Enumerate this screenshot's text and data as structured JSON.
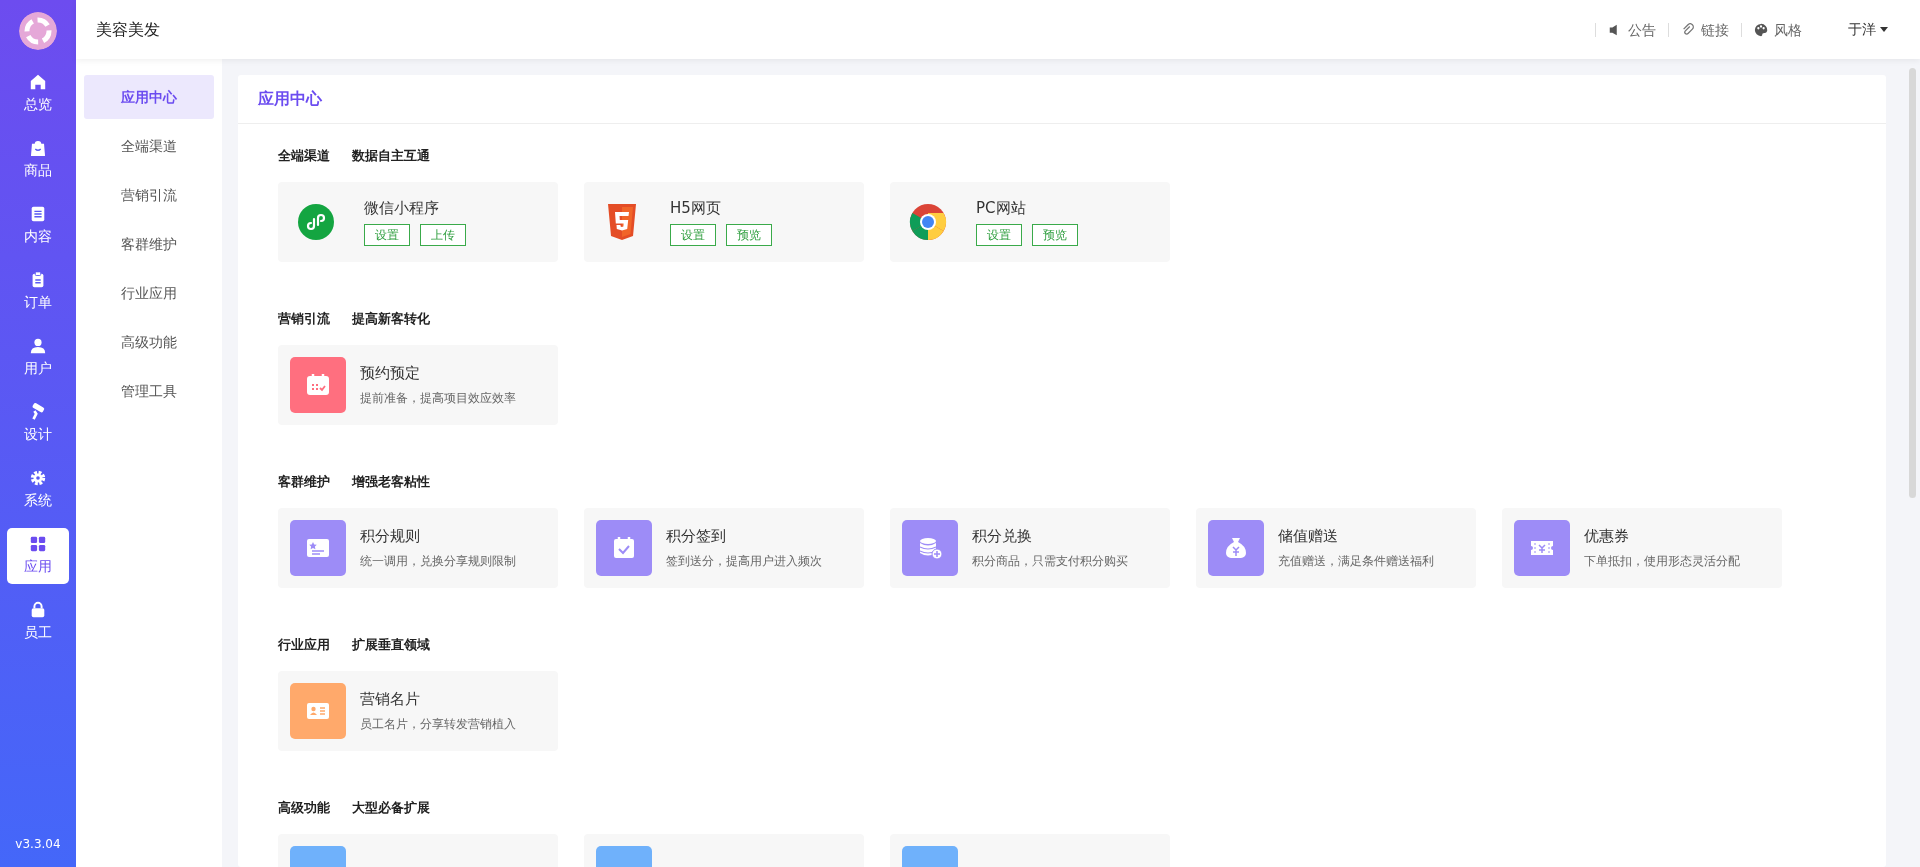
{
  "app": {
    "version": "v3.3.04"
  },
  "rail": [
    {
      "label": "总览",
      "selected": false
    },
    {
      "label": "商品",
      "selected": false
    },
    {
      "label": "内容",
      "selected": false
    },
    {
      "label": "订单",
      "selected": false
    },
    {
      "label": "用户",
      "selected": false
    },
    {
      "label": "设计",
      "selected": false
    },
    {
      "label": "系统",
      "selected": false
    },
    {
      "label": "应用",
      "selected": true
    },
    {
      "label": "员工",
      "selected": false
    }
  ],
  "header": {
    "title": "美容美发",
    "links": [
      "公告",
      "链接",
      "风格"
    ],
    "user": "于洋"
  },
  "submenu": [
    {
      "label": "应用中心",
      "selected": true
    },
    {
      "label": "全端渠道",
      "selected": false
    },
    {
      "label": "营销引流",
      "selected": false
    },
    {
      "label": "客群维护",
      "selected": false
    },
    {
      "label": "行业应用",
      "selected": false
    },
    {
      "label": "高级功能",
      "selected": false
    },
    {
      "label": "管理工具",
      "selected": false
    }
  ],
  "panel": {
    "title": "应用中心",
    "sections": [
      {
        "title": "全端渠道",
        "subtitle": "数据自主互通",
        "cards": [
          {
            "kind": "channel",
            "title": "微信小程序",
            "buttons": [
              "设置",
              "上传"
            ]
          },
          {
            "kind": "channel",
            "title": "H5网页",
            "buttons": [
              "设置",
              "预览"
            ]
          },
          {
            "kind": "channel",
            "title": "PC网站",
            "buttons": [
              "设置",
              "预览"
            ]
          }
        ]
      },
      {
        "title": "营销引流",
        "subtitle": "提高新客转化",
        "cards": [
          {
            "kind": "app",
            "color": "#ff6f7f",
            "title": "预约预定",
            "description": "提前准备，提高项目效应效率"
          }
        ]
      },
      {
        "title": "客群维护",
        "subtitle": "增强老客粘性",
        "cards": [
          {
            "kind": "app",
            "color": "#9d8cf7",
            "title": "积分规则",
            "description": "统一调用，兑换分享规则限制"
          },
          {
            "kind": "app",
            "color": "#9d8cf7",
            "title": "积分签到",
            "description": "签到送分，提高用户进入频次"
          },
          {
            "kind": "app",
            "color": "#9d8cf7",
            "title": "积分兑换",
            "description": "积分商品，只需支付积分购买"
          },
          {
            "kind": "app",
            "color": "#9d8cf7",
            "title": "储值赠送",
            "description": "充值赠送，满足条件赠送福利"
          },
          {
            "kind": "app",
            "color": "#9d8cf7",
            "title": "优惠券",
            "description": "下单抵扣，使用形态灵活分配"
          }
        ]
      },
      {
        "title": "行业应用",
        "subtitle": "扩展垂直领域",
        "cards": [
          {
            "kind": "app",
            "color": "#ffa96b",
            "title": "营销名片",
            "description": "员工名片，分享转发营销植入"
          }
        ]
      },
      {
        "title": "高级功能",
        "subtitle": "大型必备扩展",
        "cards": [
          {
            "kind": "app",
            "color": "#6fb1fb"
          },
          {
            "kind": "app",
            "color": "#6fb1fb"
          },
          {
            "kind": "app",
            "color": "#6fb1fb"
          }
        ]
      }
    ]
  }
}
